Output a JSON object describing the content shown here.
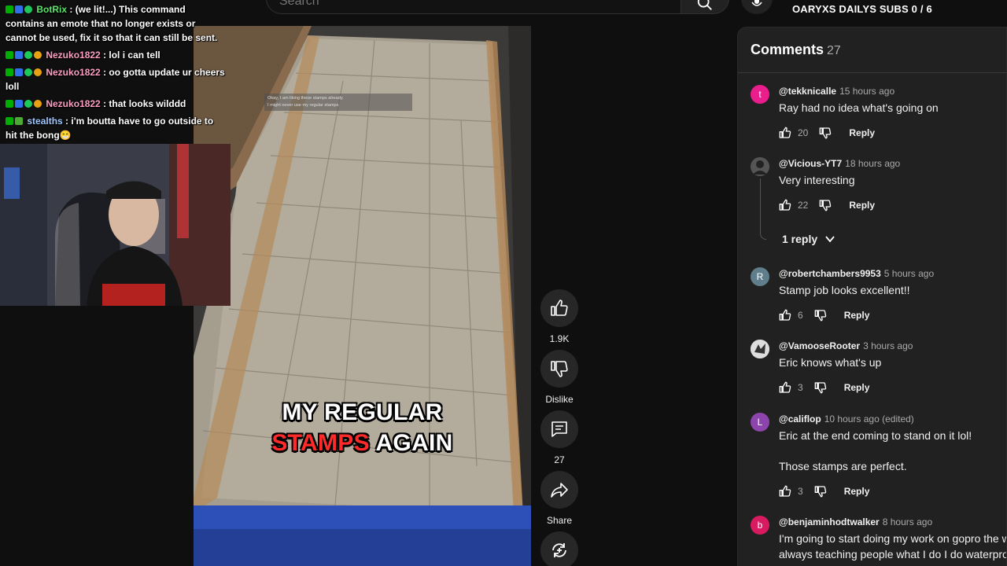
{
  "search": {
    "placeholder": "Search"
  },
  "subs_goal": "OARYXS DAILYS SUBS 0 / 6",
  "chat": [
    {
      "badges": [
        "mod",
        "vip",
        "verified"
      ],
      "user": "BotRix",
      "color": "green",
      "text": ": (we lit!...) This command contains an emote that no longer exists or cannot be used, fix it so that it can still be sent."
    },
    {
      "badges": [
        "mod",
        "vip",
        "verified",
        "sub"
      ],
      "user": "Nezuko1822",
      "color": "pink",
      "text": ": lol i can tell"
    },
    {
      "badges": [
        "mod",
        "vip",
        "verified",
        "sub"
      ],
      "user": "Nezuko1822",
      "color": "pink",
      "text": ": oo gotta update ur cheers loll"
    },
    {
      "badges": [
        "mod",
        "vip",
        "verified",
        "sub"
      ],
      "user": "Nezuko1822",
      "color": "pink",
      "text": ": that looks wilddd"
    },
    {
      "badges": [
        "mod",
        "other"
      ],
      "user": "stealths",
      "color": "blue",
      "text": ": i'm boutta have to go outside to hit the bong😁"
    }
  ],
  "video": {
    "note_line1": "Okay, I am liking these stamps already.",
    "note_line2": "I might never use my regular stamps",
    "caption_line1": "MY REGULAR",
    "caption_red": "STAMPS",
    "caption_rest": "AGAIN"
  },
  "actions": {
    "like_count": "1.9K",
    "dislike_label": "Dislike",
    "comments_count": "27",
    "share_label": "Share"
  },
  "comments": {
    "title": "Comments",
    "count": "27",
    "reply_label": "Reply",
    "items": [
      {
        "avatar_letter": "t",
        "avatar_color": "#e91e8c",
        "handle": "@tekknicalle",
        "time": "15 hours ago",
        "text": "Ray had no idea what's going on",
        "likes": "20"
      },
      {
        "avatar_letter": "",
        "avatar_color": "#444444",
        "handle": "@Vicious-YT7",
        "time": "18 hours ago",
        "text": "Very interesting",
        "likes": "22",
        "replies": "1 reply"
      },
      {
        "avatar_letter": "R",
        "avatar_color": "#607d8b",
        "handle": "@robertchambers9953",
        "time": "5 hours ago",
        "text": "Stamp job looks excellent!!",
        "likes": "6"
      },
      {
        "avatar_letter": "",
        "avatar_color": "#dddddd",
        "handle": "@VamooseRooter",
        "time": "3 hours ago",
        "text": "Eric knows what's up",
        "likes": "3"
      },
      {
        "avatar_letter": "L",
        "avatar_color": "#8e44ad",
        "handle": "@califlop",
        "time": "10 hours ago (edited)",
        "text": "Eric at the end coming to stand on it lol!",
        "text2": "Those stamps are perfect.",
        "likes": "3"
      },
      {
        "avatar_letter": "b",
        "avatar_color": "#d81b60",
        "handle": "@benjaminhodtwalker",
        "time": "8 hours ago",
        "text": "I'm going to start doing my work on gopro the w",
        "text2": "always teaching people what I do I do waterproo"
      }
    ]
  }
}
